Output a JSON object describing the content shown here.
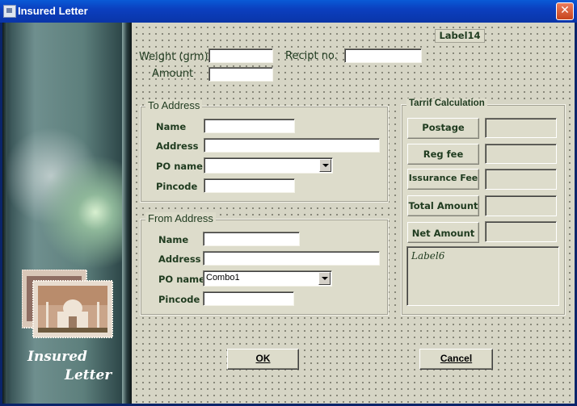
{
  "window": {
    "title": "Insured Letter",
    "close_glyph": "✕"
  },
  "side": {
    "title_line1": "Insured",
    "title_line2": "Letter"
  },
  "header": {
    "label14": "Label14",
    "weight_label": "Weight (grm)",
    "weight_value": "",
    "recipt_label": "Recipt no.",
    "recipt_value": "",
    "amount_label": "Amount",
    "amount_value": ""
  },
  "to_address": {
    "title": "To Address",
    "name_label": "Name",
    "name_value": "",
    "address_label": "Address",
    "address_value": "",
    "po_label": "PO name",
    "po_value": "",
    "pincode_label": "Pincode",
    "pincode_value": ""
  },
  "from_address": {
    "title": "From Address",
    "name_label": "Name",
    "name_value": "",
    "address_label": "Address",
    "address_value": "",
    "po_label": "PO name",
    "po_value": "Combo1",
    "pincode_label": "Pincode",
    "pincode_value": ""
  },
  "tarrif": {
    "title": "Tarrif Calculation",
    "rows": [
      {
        "label": "Postage",
        "value": ""
      },
      {
        "label": "Reg fee",
        "value": ""
      },
      {
        "label": "Issurance Fee",
        "value": ""
      },
      {
        "label": "Total Amount",
        "value": ""
      },
      {
        "label": "Net Amount",
        "value": ""
      }
    ],
    "label6": "Label6"
  },
  "buttons": {
    "ok": "OK",
    "cancel": "Cancel"
  },
  "colors": {
    "title_bar": "#0b3fbf",
    "form_bg": "#d6d5c5",
    "label_text": "#1f3b1f"
  }
}
